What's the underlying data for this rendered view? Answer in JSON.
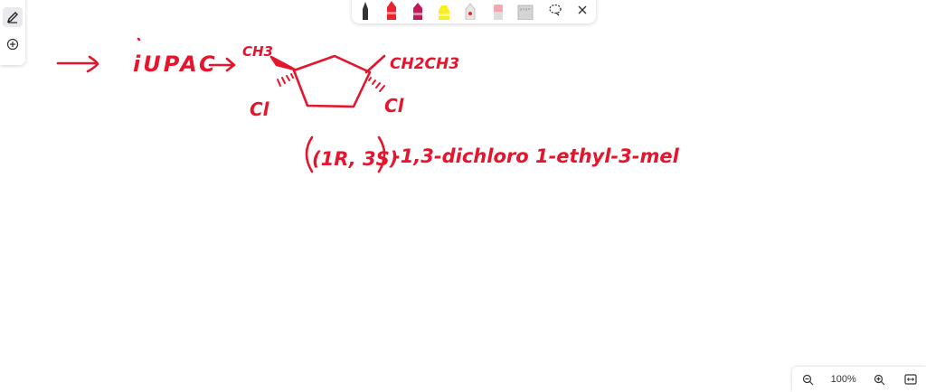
{
  "toolbar": {
    "tools": [
      {
        "name": "pen-black",
        "color": "#333333"
      },
      {
        "name": "pen-red",
        "color": "#e8242f"
      },
      {
        "name": "pen-magenta",
        "color": "#c2185b"
      },
      {
        "name": "highlighter-yellow",
        "color": "#f5ef24"
      },
      {
        "name": "marker-white",
        "color": "#d9d9d9"
      },
      {
        "name": "eraser",
        "color": "#f4a7ad"
      },
      {
        "name": "ruler",
        "color": "#c7c7c7"
      }
    ],
    "icons": [
      "lasso-icon",
      "close-icon"
    ]
  },
  "left_toolbar": {
    "icons": [
      "pen-icon",
      "add-icon"
    ]
  },
  "ink": {
    "color": "#e4152d",
    "iupac": "iUPAC",
    "label_ch3": "CH3",
    "label_ch2ch3": "CH2CH3",
    "label_cl_left": "Cl",
    "label_cl_right": "Cl",
    "answer_stereo": "(1R, 3S)",
    "answer_name": "-1,3-dichloro 1-ethyl-3-mel"
  },
  "zoom": {
    "level": "100%"
  }
}
